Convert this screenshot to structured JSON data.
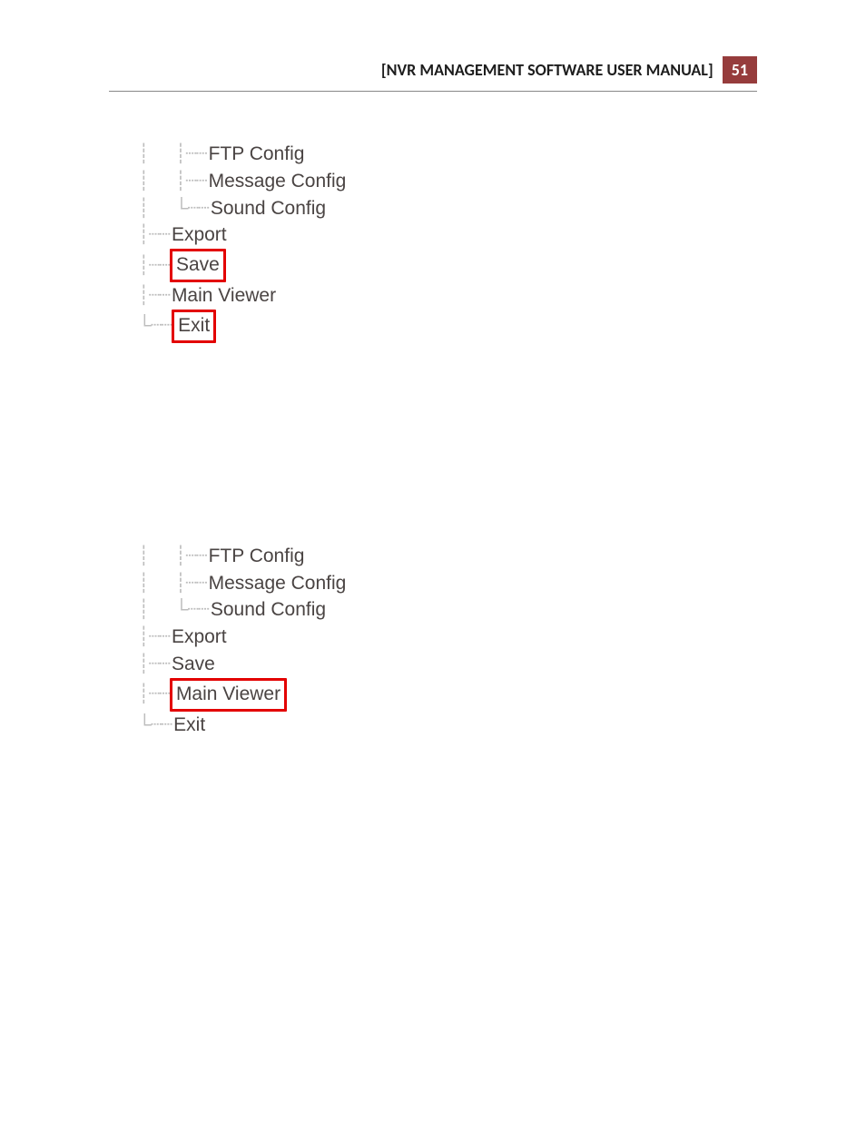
{
  "header": {
    "title": "[NVR MANAGEMENT SOFTWARE USER MANUAL]",
    "page_number": "51"
  },
  "tree_a": {
    "ftp": "FTP Config",
    "message": "Message Config",
    "sound": "Sound Config",
    "export": "Export",
    "save": "Save",
    "main": "Main Viewer",
    "exit": "Exit"
  },
  "tree_b": {
    "ftp": "FTP Config",
    "message": "Message Config",
    "sound": "Sound Config",
    "export": "Export",
    "save": "Save",
    "main": "Main Viewer",
    "exit": "Exit"
  }
}
